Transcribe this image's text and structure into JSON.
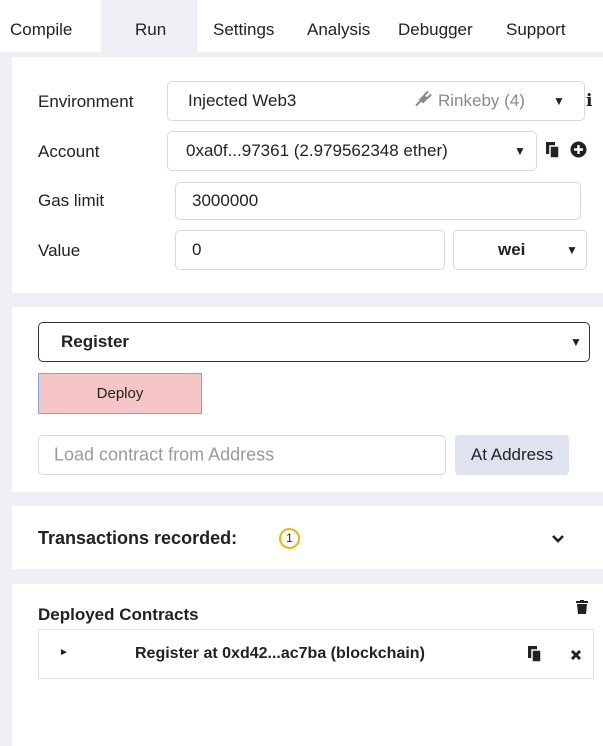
{
  "tabs": [
    "Compile",
    "Run",
    "Settings",
    "Analysis",
    "Debugger",
    "Support"
  ],
  "environment": {
    "label": "Environment",
    "value": "Injected Web3",
    "network": "Rinkeby (4)",
    "info": "i"
  },
  "account": {
    "label": "Account",
    "value": "0xa0f...97361 (2.979562348 ether)"
  },
  "gas_limit": {
    "label": "Gas limit",
    "value": "3000000"
  },
  "value": {
    "label": "Value",
    "amount": "0",
    "unit": "wei"
  },
  "contract": {
    "selected": "Register",
    "deploy_label": "Deploy",
    "address_placeholder": "Load contract from Address",
    "at_address_label": "At Address"
  },
  "transactions": {
    "label": "Transactions recorded:",
    "count": "1"
  },
  "deployed": {
    "title": "Deployed Contracts",
    "items": [
      {
        "label": "Register at 0xd42...ac7ba (blockchain)"
      }
    ]
  },
  "colors": {
    "deploy_bg": "#f6c6c6",
    "badge": "#f0b400",
    "background": "#eef0f6"
  }
}
